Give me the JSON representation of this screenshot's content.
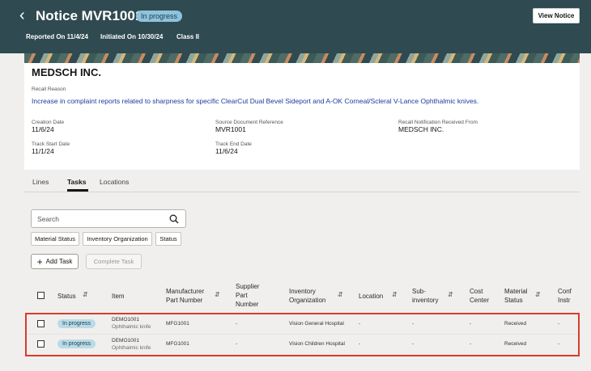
{
  "header": {
    "title": "Notice MVR1001",
    "status": "In progress",
    "reported": "Reported On 11/4/24",
    "initiated": "Initiated On 10/30/24",
    "class": "Class II",
    "view_button": "View Notice"
  },
  "summary": {
    "company": "MEDSCH INC.",
    "recall_reason_label": "Recall Reason",
    "recall_reason": "Increase in complaint reports related to sharpness for specific ClearCut Dual Bevel Sideport and A-OK Corneal/Scleral V-Lance Ophthalmic knives.",
    "creation_date_label": "Creation Date",
    "creation_date": "11/6/24",
    "source_ref_label": "Source Document Reference",
    "source_ref": "MVR1001",
    "received_from_label": "Recall Notification Received From",
    "received_from": "MEDSCH INC.",
    "track_start_label": "Track Start Date",
    "track_start": "11/1/24",
    "track_end_label": "Track End Date",
    "track_end": "11/6/24"
  },
  "tabs": [
    "Lines",
    "Tasks",
    "Locations"
  ],
  "search": {
    "placeholder": "Search"
  },
  "filters": [
    "Material Status",
    "Inventory Organization",
    "Status"
  ],
  "actions": {
    "add": "Add Task",
    "complete": "Complete Task"
  },
  "table": {
    "columns": {
      "status": "Status",
      "item": "Item",
      "mfg_1": "Manufacturer",
      "mfg_2": "Part Number",
      "sup_1": "Supplier",
      "sup_2": "Part",
      "sup_3": "Number",
      "inv_1": "Inventory",
      "inv_2": "Organization",
      "location": "Location",
      "subinv_1": "Sub-",
      "subinv_2": "inventory",
      "cost_1": "Cost",
      "cost_2": "Center",
      "mat_1": "Material",
      "mat_2": "Status",
      "conf_1": "Conf",
      "conf_2": "Instr"
    },
    "rows": [
      {
        "status": "In progress",
        "item": "DEMO1001",
        "item_desc": "Ophthalmic knife",
        "mfg_part": "MFG1001",
        "supplier_part": "-",
        "inv_org": "Vision General Hospital",
        "location": "-",
        "subinventory": "-",
        "cost_center": "-",
        "material_status": "Received",
        "conf": "-"
      },
      {
        "status": "In progress",
        "item": "DEMO1001",
        "item_desc": "Ophthalmic knife",
        "mfg_part": "MFG1001",
        "supplier_part": "-",
        "inv_org": "Vision Children Hospital",
        "location": "-",
        "subinventory": "-",
        "cost_center": "-",
        "material_status": "Received",
        "conf": "-"
      }
    ]
  }
}
